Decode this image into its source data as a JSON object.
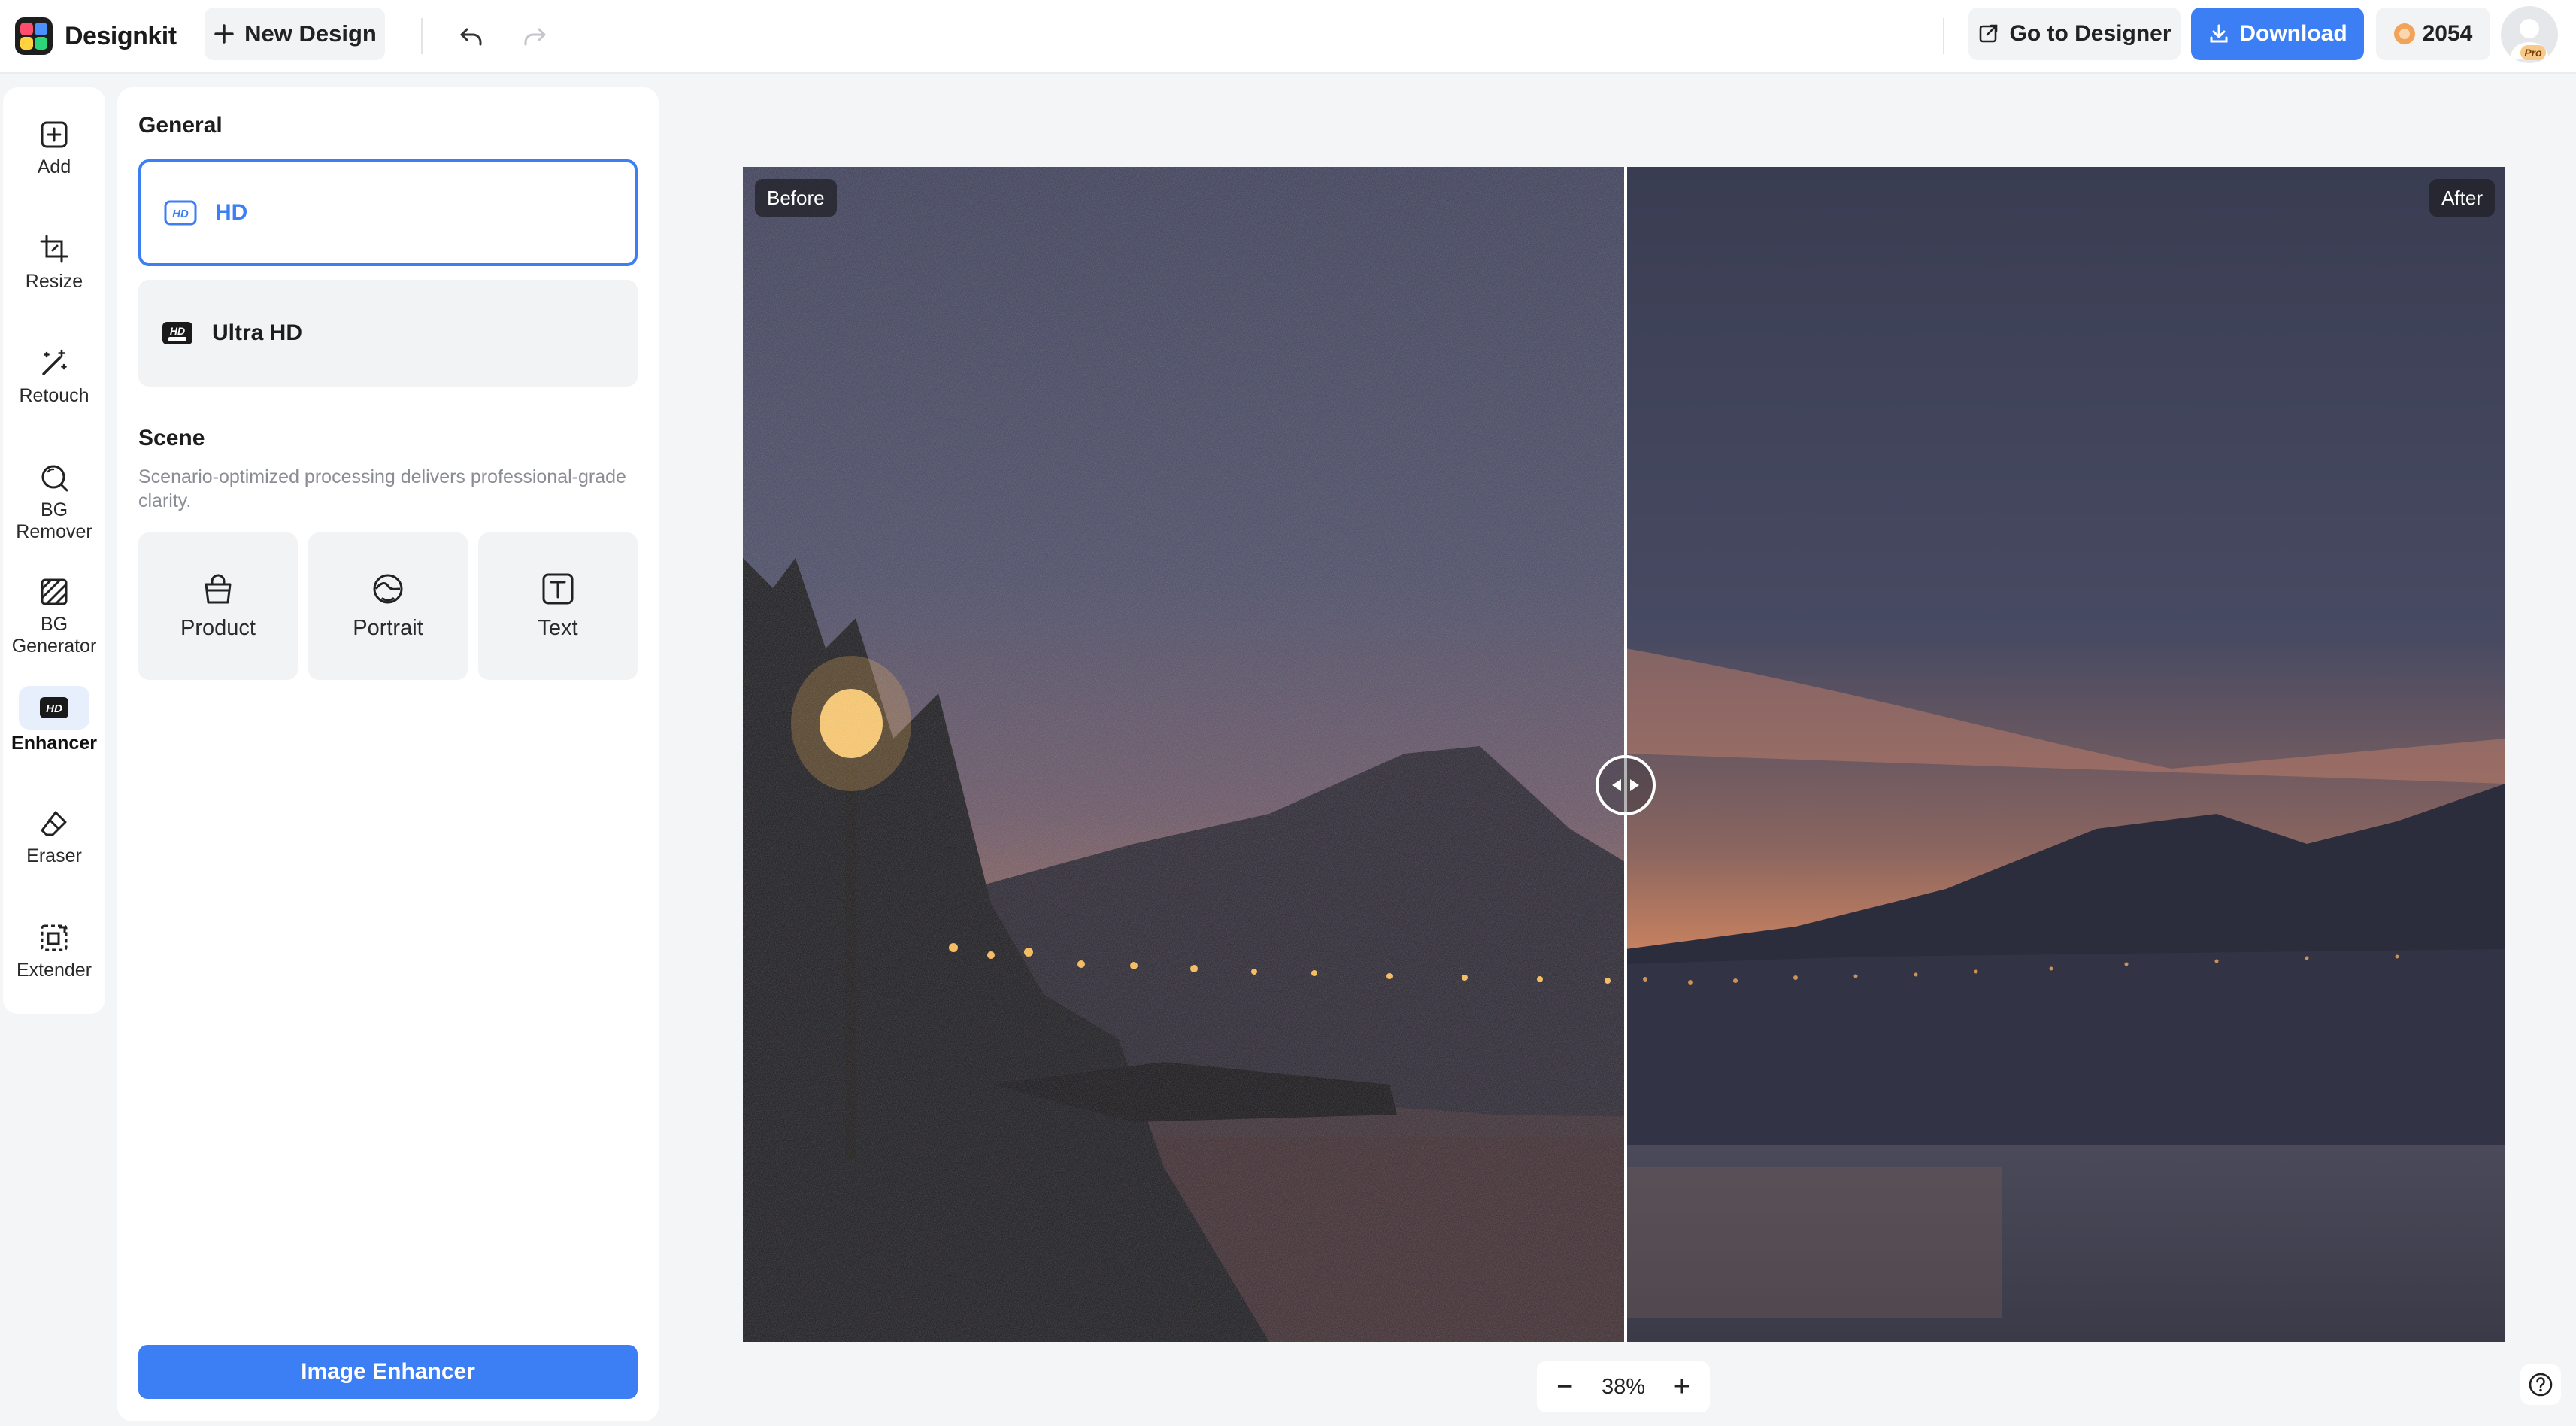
{
  "app": {
    "brand_name": "Designkit",
    "new_design_label": "New Design",
    "go_to_designer_label": "Go to Designer",
    "download_label": "Download",
    "credits": "2054",
    "pro_badge": "Pro",
    "accent_color": "#3c7ef4"
  },
  "rail": {
    "items": [
      {
        "label": "Add",
        "icon": "add-square-icon"
      },
      {
        "label": "Resize",
        "icon": "crop-icon"
      },
      {
        "label": "Retouch",
        "icon": "magic-wand-icon"
      },
      {
        "label": "BG Remover",
        "icon": "bg-remover-icon"
      },
      {
        "label": "BG Generator",
        "icon": "bg-generator-icon"
      },
      {
        "label": "Enhancer",
        "icon": "hd-icon",
        "active": true
      },
      {
        "label": "Eraser",
        "icon": "eraser-icon"
      },
      {
        "label": "Extender",
        "icon": "extender-icon"
      }
    ]
  },
  "panel": {
    "general_title": "General",
    "options": [
      {
        "label": "HD",
        "icon": "hd-icon",
        "selected": true
      },
      {
        "label": "Ultra HD",
        "icon": "ultra-hd-icon",
        "selected": false
      }
    ],
    "scene_title": "Scene",
    "scene_description": "Scenario-optimized processing delivers professional-grade clarity.",
    "scenes": [
      {
        "label": "Product",
        "icon": "bag-icon"
      },
      {
        "label": "Portrait",
        "icon": "face-icon"
      },
      {
        "label": "Text",
        "icon": "text-icon"
      }
    ],
    "enhance_button": "Image Enhancer"
  },
  "canvas": {
    "before_label": "Before",
    "after_label": "After",
    "zoom_level": "38%"
  }
}
